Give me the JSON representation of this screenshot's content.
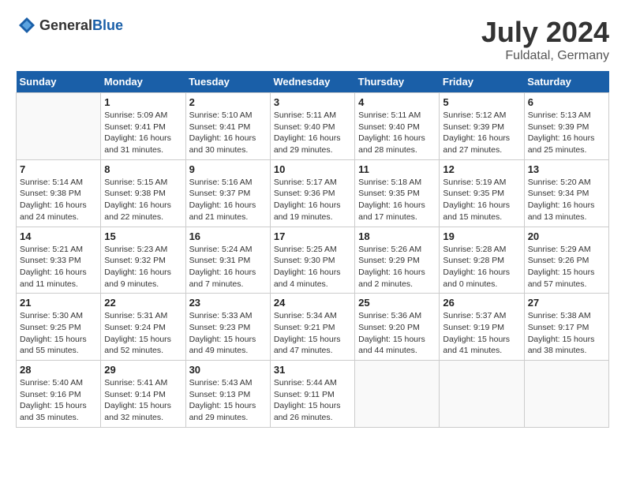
{
  "header": {
    "logo_general": "General",
    "logo_blue": "Blue",
    "month_year": "July 2024",
    "location": "Fuldatal, Germany"
  },
  "days_of_week": [
    "Sunday",
    "Monday",
    "Tuesday",
    "Wednesday",
    "Thursday",
    "Friday",
    "Saturday"
  ],
  "weeks": [
    [
      {
        "day": "",
        "info": ""
      },
      {
        "day": "1",
        "info": "Sunrise: 5:09 AM\nSunset: 9:41 PM\nDaylight: 16 hours\nand 31 minutes."
      },
      {
        "day": "2",
        "info": "Sunrise: 5:10 AM\nSunset: 9:41 PM\nDaylight: 16 hours\nand 30 minutes."
      },
      {
        "day": "3",
        "info": "Sunrise: 5:11 AM\nSunset: 9:40 PM\nDaylight: 16 hours\nand 29 minutes."
      },
      {
        "day": "4",
        "info": "Sunrise: 5:11 AM\nSunset: 9:40 PM\nDaylight: 16 hours\nand 28 minutes."
      },
      {
        "day": "5",
        "info": "Sunrise: 5:12 AM\nSunset: 9:39 PM\nDaylight: 16 hours\nand 27 minutes."
      },
      {
        "day": "6",
        "info": "Sunrise: 5:13 AM\nSunset: 9:39 PM\nDaylight: 16 hours\nand 25 minutes."
      }
    ],
    [
      {
        "day": "7",
        "info": "Sunrise: 5:14 AM\nSunset: 9:38 PM\nDaylight: 16 hours\nand 24 minutes."
      },
      {
        "day": "8",
        "info": "Sunrise: 5:15 AM\nSunset: 9:38 PM\nDaylight: 16 hours\nand 22 minutes."
      },
      {
        "day": "9",
        "info": "Sunrise: 5:16 AM\nSunset: 9:37 PM\nDaylight: 16 hours\nand 21 minutes."
      },
      {
        "day": "10",
        "info": "Sunrise: 5:17 AM\nSunset: 9:36 PM\nDaylight: 16 hours\nand 19 minutes."
      },
      {
        "day": "11",
        "info": "Sunrise: 5:18 AM\nSunset: 9:35 PM\nDaylight: 16 hours\nand 17 minutes."
      },
      {
        "day": "12",
        "info": "Sunrise: 5:19 AM\nSunset: 9:35 PM\nDaylight: 16 hours\nand 15 minutes."
      },
      {
        "day": "13",
        "info": "Sunrise: 5:20 AM\nSunset: 9:34 PM\nDaylight: 16 hours\nand 13 minutes."
      }
    ],
    [
      {
        "day": "14",
        "info": "Sunrise: 5:21 AM\nSunset: 9:33 PM\nDaylight: 16 hours\nand 11 minutes."
      },
      {
        "day": "15",
        "info": "Sunrise: 5:23 AM\nSunset: 9:32 PM\nDaylight: 16 hours\nand 9 minutes."
      },
      {
        "day": "16",
        "info": "Sunrise: 5:24 AM\nSunset: 9:31 PM\nDaylight: 16 hours\nand 7 minutes."
      },
      {
        "day": "17",
        "info": "Sunrise: 5:25 AM\nSunset: 9:30 PM\nDaylight: 16 hours\nand 4 minutes."
      },
      {
        "day": "18",
        "info": "Sunrise: 5:26 AM\nSunset: 9:29 PM\nDaylight: 16 hours\nand 2 minutes."
      },
      {
        "day": "19",
        "info": "Sunrise: 5:28 AM\nSunset: 9:28 PM\nDaylight: 16 hours\nand 0 minutes."
      },
      {
        "day": "20",
        "info": "Sunrise: 5:29 AM\nSunset: 9:26 PM\nDaylight: 15 hours\nand 57 minutes."
      }
    ],
    [
      {
        "day": "21",
        "info": "Sunrise: 5:30 AM\nSunset: 9:25 PM\nDaylight: 15 hours\nand 55 minutes."
      },
      {
        "day": "22",
        "info": "Sunrise: 5:31 AM\nSunset: 9:24 PM\nDaylight: 15 hours\nand 52 minutes."
      },
      {
        "day": "23",
        "info": "Sunrise: 5:33 AM\nSunset: 9:23 PM\nDaylight: 15 hours\nand 49 minutes."
      },
      {
        "day": "24",
        "info": "Sunrise: 5:34 AM\nSunset: 9:21 PM\nDaylight: 15 hours\nand 47 minutes."
      },
      {
        "day": "25",
        "info": "Sunrise: 5:36 AM\nSunset: 9:20 PM\nDaylight: 15 hours\nand 44 minutes."
      },
      {
        "day": "26",
        "info": "Sunrise: 5:37 AM\nSunset: 9:19 PM\nDaylight: 15 hours\nand 41 minutes."
      },
      {
        "day": "27",
        "info": "Sunrise: 5:38 AM\nSunset: 9:17 PM\nDaylight: 15 hours\nand 38 minutes."
      }
    ],
    [
      {
        "day": "28",
        "info": "Sunrise: 5:40 AM\nSunset: 9:16 PM\nDaylight: 15 hours\nand 35 minutes."
      },
      {
        "day": "29",
        "info": "Sunrise: 5:41 AM\nSunset: 9:14 PM\nDaylight: 15 hours\nand 32 minutes."
      },
      {
        "day": "30",
        "info": "Sunrise: 5:43 AM\nSunset: 9:13 PM\nDaylight: 15 hours\nand 29 minutes."
      },
      {
        "day": "31",
        "info": "Sunrise: 5:44 AM\nSunset: 9:11 PM\nDaylight: 15 hours\nand 26 minutes."
      },
      {
        "day": "",
        "info": ""
      },
      {
        "day": "",
        "info": ""
      },
      {
        "day": "",
        "info": ""
      }
    ]
  ]
}
